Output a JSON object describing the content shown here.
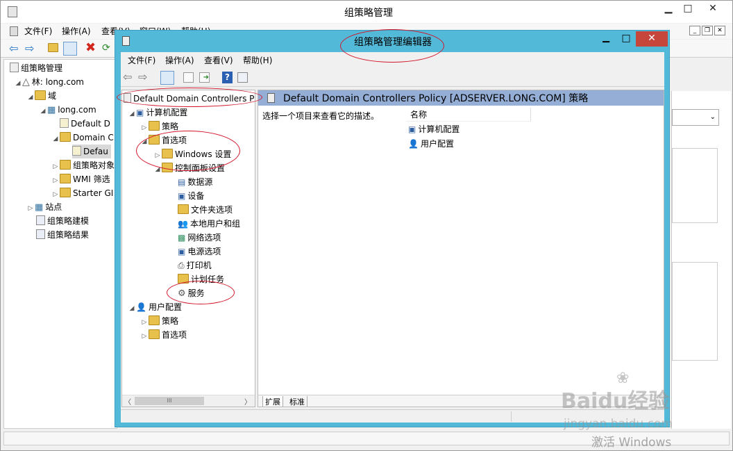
{
  "bg_window": {
    "title": "组策略管理",
    "menu": [
      "文件(F)",
      "操作(A)",
      "查看(V)",
      "窗口(W)",
      "帮助(H)"
    ],
    "tree": [
      {
        "label": "组策略管理"
      },
      {
        "label": "林: long.com"
      },
      {
        "label": "域"
      },
      {
        "label": "long.com"
      },
      {
        "label": "Default D"
      },
      {
        "label": "Domain C"
      },
      {
        "label": "Defau"
      },
      {
        "label": "组策略对象"
      },
      {
        "label": "WMI 筛选"
      },
      {
        "label": "Starter GI"
      },
      {
        "label": "站点"
      },
      {
        "label": "组策略建模"
      },
      {
        "label": "组策略结果"
      }
    ]
  },
  "editor": {
    "title": "组策略管理编辑器",
    "menu": [
      "文件(F)",
      "操作(A)",
      "查看(V)",
      "帮助(H)"
    ],
    "tree_root": "Default Domain Controllers P",
    "tree": [
      {
        "label": "计算机配置"
      },
      {
        "label": "策略"
      },
      {
        "label": "首选项"
      },
      {
        "label": "Windows 设置"
      },
      {
        "label": "控制面板设置"
      },
      {
        "label": "数据源"
      },
      {
        "label": "设备"
      },
      {
        "label": "文件夹选项"
      },
      {
        "label": "本地用户和组"
      },
      {
        "label": "网络选项"
      },
      {
        "label": "电源选项"
      },
      {
        "label": "打印机"
      },
      {
        "label": "计划任务"
      },
      {
        "label": "服务"
      },
      {
        "label": "用户配置"
      },
      {
        "label": "策略"
      },
      {
        "label": "首选项"
      }
    ],
    "header": "Default Domain Controllers Policy [ADSERVER.LONG.COM] 策略",
    "description": "选择一个项目来查看它的描述。",
    "column_name": "名称",
    "items": [
      "计算机配置",
      "用户配置"
    ],
    "tabs": [
      "扩展",
      "标准"
    ]
  },
  "watermark": {
    "brand": "Baidu经验",
    "url": "jingyan.baidu.com",
    "activate": "激活 Windows"
  }
}
